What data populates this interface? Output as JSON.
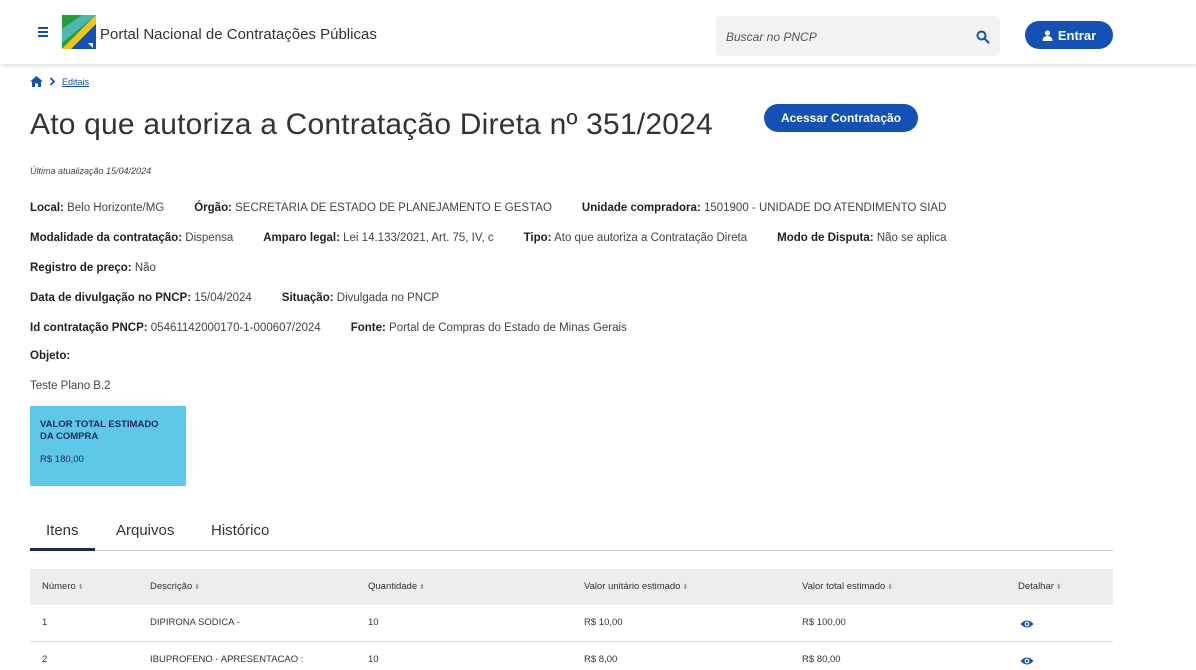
{
  "header": {
    "site_title": "Portal Nacional de Contratações Públicas",
    "search_placeholder": "Buscar no PNCP",
    "login_label": "Entrar"
  },
  "breadcrumb": {
    "home_icon": "home-icon",
    "items": [
      "Editais"
    ]
  },
  "page": {
    "title": "Ato que autoriza a Contratação Direta nº 351/2024",
    "access_button": "Acessar Contratação",
    "updated": "Última atualização 15/04/2024"
  },
  "info": {
    "local_label": "Local:",
    "local_value": "Belo Horizonte/MG",
    "orgao_label": "Órgão:",
    "orgao_value": "SECRETARIA DE ESTADO DE PLANEJAMENTO E GESTAO",
    "unidade_label": "Unidade compradora:",
    "unidade_value": "1501900 - UNIDADE DO ATENDIMENTO SIAD",
    "modalidade_label": "Modalidade da contratação:",
    "modalidade_value": "Dispensa",
    "amparo_label": "Amparo legal:",
    "amparo_value": "Lei 14.133/2021, Art. 75, IV, c",
    "tipo_label": "Tipo:",
    "tipo_value": "Ato que autoriza a Contratação Direta",
    "disputa_label": "Modo de Disputa:",
    "disputa_value": "Não se aplica",
    "registro_label": "Registro de preço:",
    "registro_value": "Não",
    "divulgacao_label": "Data de divulgação no PNCP:",
    "divulgacao_value": "15/04/2024",
    "situacao_label": "Situação:",
    "situacao_value": "Divulgada no PNCP",
    "id_label": "Id contratação PNCP:",
    "id_value": "05461142000170-1-000607/2024",
    "fonte_label": "Fonte:",
    "fonte_value": "Portal de Compras do Estado de Minas Gerais",
    "objeto_label": "Objeto:",
    "objeto_value": "Teste Plano B.2"
  },
  "value_card": {
    "label_line1": "VALOR TOTAL ESTIMADO",
    "label_line2": "DA COMPRA",
    "amount": "R$ 180,00"
  },
  "tabs": [
    {
      "label": "Itens",
      "active": true
    },
    {
      "label": "Arquivos",
      "active": false
    },
    {
      "label": "Histórico",
      "active": false
    }
  ],
  "table": {
    "columns": [
      "Número",
      "Descrição",
      "Quantidade",
      "Valor unitário estimado",
      "Valor total estimado",
      "Detalhar"
    ],
    "rows": [
      {
        "numero": "1",
        "descricao": "DIPIRONA SODICA -",
        "quantidade": "10",
        "unitario": "R$ 10,00",
        "total": "R$ 100,00"
      },
      {
        "numero": "2",
        "descricao": "IBUPROFENO - APRESENTACAO :",
        "quantidade": "10",
        "unitario": "R$ 8,00",
        "total": "R$ 80,00"
      }
    ]
  },
  "colors": {
    "primary": "#1351b4",
    "card": "#5fc8e8",
    "tab_underline": "#1b2a57"
  }
}
